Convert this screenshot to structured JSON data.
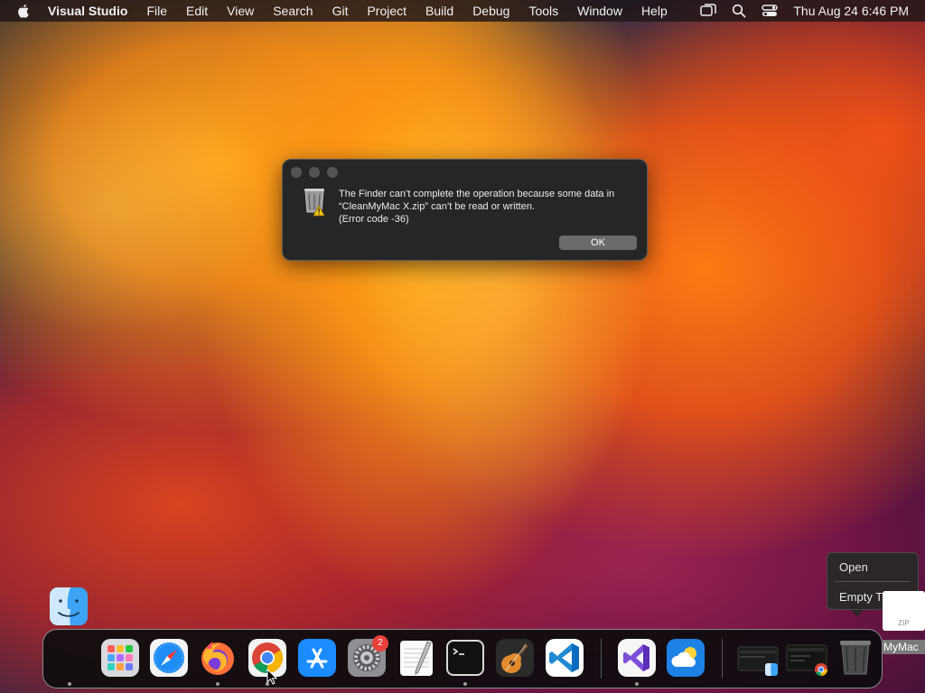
{
  "menubar": {
    "app_name": "Visual Studio",
    "items": [
      "File",
      "Edit",
      "View",
      "Search",
      "Git",
      "Project",
      "Build",
      "Debug",
      "Tools",
      "Window",
      "Help"
    ],
    "clock": "Thu Aug 24  6:46 PM"
  },
  "dialog": {
    "line1": "The Finder can’t complete the operation because some data in",
    "line2": "“CleanMyMac X.zip” can’t be read or written.",
    "line3": "(Error code -36)",
    "ok_label": "OK"
  },
  "context_menu": {
    "open": "Open",
    "empty_trash": "Empty Trash"
  },
  "desktop_file": {
    "kind": "ZIP",
    "label": "MyMac"
  },
  "dock": {
    "badge_count": "2",
    "icons": [
      "launchpad-icon",
      "safari-icon",
      "firefox-icon",
      "chrome-icon",
      "app-store-icon",
      "system-settings-icon",
      "textedit-icon",
      "terminal-icon",
      "garageband-icon",
      "vscode-icon",
      "visual-studio-icon",
      "weather-icon",
      "finder-window-icon",
      "chrome-window-icon",
      "trash-icon"
    ]
  },
  "colors": {
    "menubar_bg": "#1e1618",
    "dialog_bg": "#262626",
    "badge": "#e8413a"
  }
}
